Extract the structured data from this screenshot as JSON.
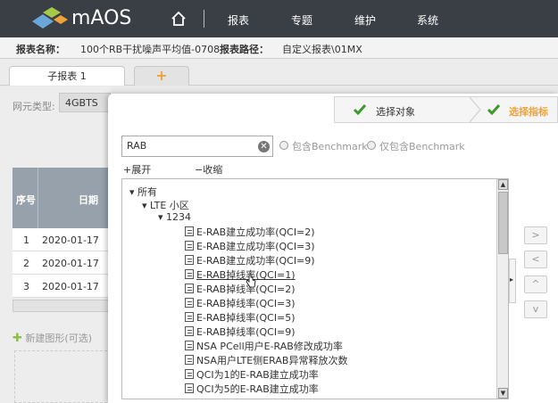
{
  "app": {
    "brand": "mAOS",
    "nav": [
      "报表",
      "专题",
      "维护",
      "系统"
    ]
  },
  "info": {
    "name_label": "报表名称：",
    "name_value": "100个RB干扰噪声平均值-0708",
    "path_label": "报表路径：",
    "path_value": "自定义报表\\01MX"
  },
  "tabs": {
    "active": "子报表 1",
    "add": "+"
  },
  "left": {
    "net_label": "网元类型:",
    "net_value": "4GBTS",
    "col_seq": "序号",
    "col_date": "日期",
    "rows": [
      {
        "seq": "1",
        "date": "2020-01-17"
      },
      {
        "seq": "2",
        "date": "2020-01-17"
      },
      {
        "seq": "3",
        "date": "2020-01-17"
      }
    ],
    "new_chart": "新建图形(可选)"
  },
  "modal": {
    "step1": "选择对象",
    "step2": "选择指标",
    "search_value": "RAB",
    "radio1": "包含Benchmark",
    "radio2": "仅包含Benchmark",
    "expand": "+展开",
    "collapse": "−收缩",
    "tree": {
      "root": "所有",
      "lte": "LTE 小区",
      "group": "1234",
      "items": [
        "E-RAB建立成功率(QCI=2)",
        "E-RAB建立成功率(QCI=3)",
        "E-RAB建立成功率(QCI=9)",
        "E-RAB掉线率(QCI=1)",
        "E-RAB掉线率(QCI=2)",
        "E-RAB掉线率(QCI=3)",
        "E-RAB掉线率(QCI=5)",
        "E-RAB掉线率(QCI=9)",
        "NSA PCell用户E-RAB修改成功率",
        "NSA用户LTE侧ERAB异常释放次数",
        "QCI为1的E-RAB建立成功率",
        "QCI为5的E-RAB建立成功率"
      ]
    },
    "arrows": [
      ">",
      "<",
      "^",
      "v"
    ]
  }
}
